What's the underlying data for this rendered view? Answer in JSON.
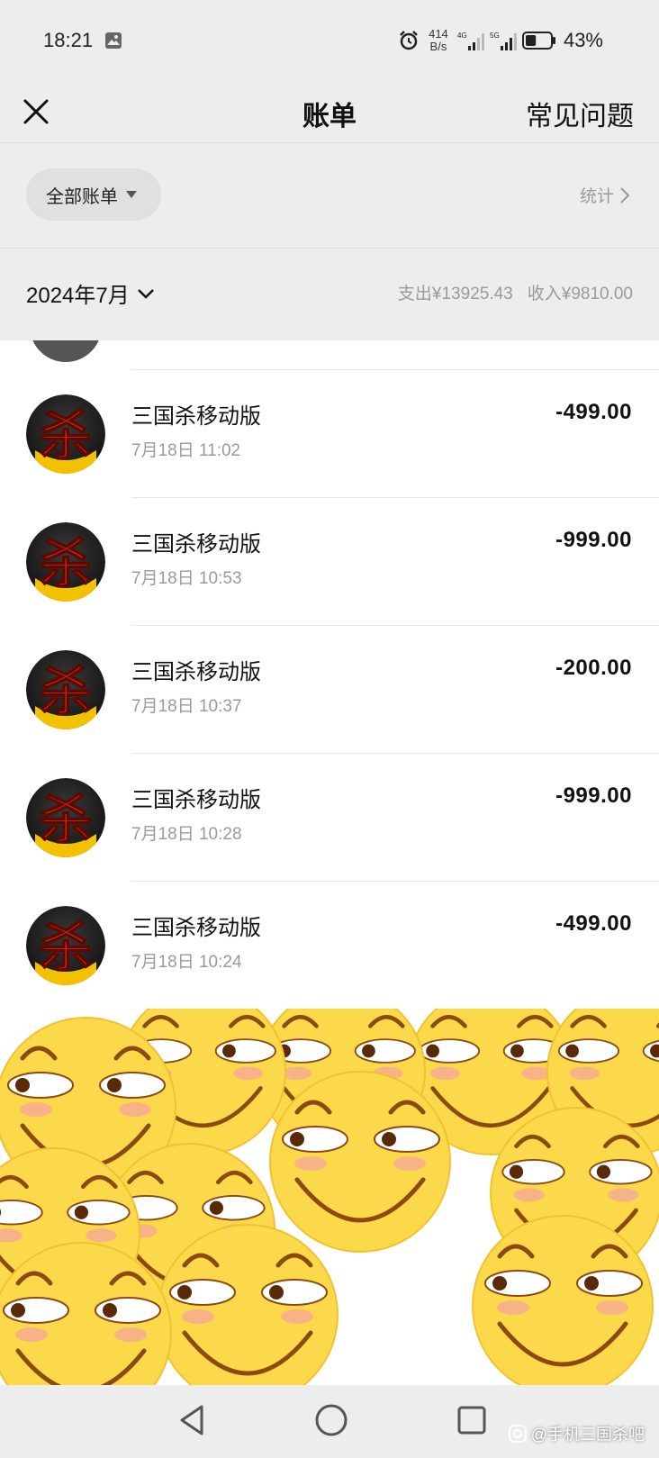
{
  "status_bar": {
    "time": "18:21",
    "net_speed_value": "414",
    "net_speed_unit": "B/s",
    "signal_1_label": "4G",
    "signal_2_label": "5G",
    "battery_percent": "43%",
    "battery_level": 0.43,
    "icons": [
      "gallery-icon",
      "alarm-icon",
      "signal-icon",
      "battery-icon"
    ]
  },
  "nav": {
    "title": "账单",
    "faq_label": "常见问题",
    "close_icon": "close-icon"
  },
  "filter": {
    "all_bills_label": "全部账单",
    "stats_label": "统计"
  },
  "month": {
    "label": "2024年7月",
    "expense_label": "支出¥13925.43",
    "income_label": "收入¥9810.00"
  },
  "transactions": [
    {
      "name": "三国杀移动版",
      "time": "7月18日 11:02",
      "amount": "-499.00"
    },
    {
      "name": "三国杀移动版",
      "time": "7月18日 10:53",
      "amount": "-999.00"
    },
    {
      "name": "三国杀移动版",
      "time": "7月18日 10:37",
      "amount": "-200.00"
    },
    {
      "name": "三国杀移动版",
      "time": "7月18日 10:28",
      "amount": "-999.00"
    },
    {
      "name": "三国杀移动版",
      "time": "7月18日 10:24",
      "amount": "-499.00"
    }
  ],
  "avatar_glyph": "杀",
  "watermark": "@手机三国杀吧",
  "colors": {
    "background_gray": "#ededed",
    "text_secondary": "#9a9a9a",
    "emoji_yellow": "#fbd94a"
  }
}
